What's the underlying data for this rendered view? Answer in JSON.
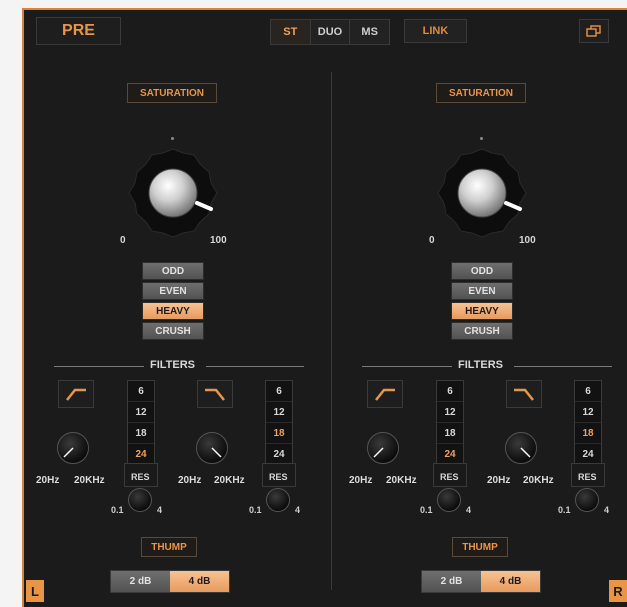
{
  "top": {
    "pre_label": "PRE",
    "modes": [
      {
        "label": "ST",
        "active": true
      },
      {
        "label": "DUO",
        "active": false
      },
      {
        "label": "MS",
        "active": false
      }
    ],
    "link_label": "LINK",
    "window_icon": "window-icon"
  },
  "channels": [
    {
      "badge": "L",
      "saturation_label": "SATURATION",
      "knob_min": "0",
      "knob_max": "100",
      "modes": [
        {
          "label": "ODD",
          "active": false
        },
        {
          "label": "EVEN",
          "active": false
        },
        {
          "label": "HEAVY",
          "active": true
        },
        {
          "label": "CRUSH",
          "active": false
        }
      ],
      "filters_label": "FILTERS",
      "hp": {
        "min": "20Hz",
        "max": "20KHz",
        "slopes": [
          "6",
          "12",
          "18",
          "24"
        ],
        "active_slope": "24"
      },
      "lp": {
        "min": "20Hz",
        "max": "20KHz",
        "slopes": [
          "6",
          "12",
          "18",
          "24"
        ],
        "active_slope": "18"
      },
      "res_label": "RES",
      "res_min": "0.1",
      "res_max": "4",
      "thump_label": "THUMP",
      "db_options": [
        {
          "label": "2 dB",
          "active": false
        },
        {
          "label": "4 dB",
          "active": true
        }
      ]
    },
    {
      "badge": "R",
      "saturation_label": "SATURATION",
      "knob_min": "0",
      "knob_max": "100",
      "modes": [
        {
          "label": "ODD",
          "active": false
        },
        {
          "label": "EVEN",
          "active": false
        },
        {
          "label": "HEAVY",
          "active": true
        },
        {
          "label": "CRUSH",
          "active": false
        }
      ],
      "filters_label": "FILTERS",
      "hp": {
        "min": "20Hz",
        "max": "20KHz",
        "slopes": [
          "6",
          "12",
          "18",
          "24"
        ],
        "active_slope": "24"
      },
      "lp": {
        "min": "20Hz",
        "max": "20KHz",
        "slopes": [
          "6",
          "12",
          "18",
          "24"
        ],
        "active_slope": "18"
      },
      "res_label": "RES",
      "res_min": "0.1",
      "res_max": "4",
      "thump_label": "THUMP",
      "db_options": [
        {
          "label": "2 dB",
          "active": false
        },
        {
          "label": "4 dB",
          "active": true
        }
      ]
    }
  ],
  "colors": {
    "accent": "#e89546",
    "active_button": "#f2b47c",
    "bg": "#1b1b1b"
  }
}
